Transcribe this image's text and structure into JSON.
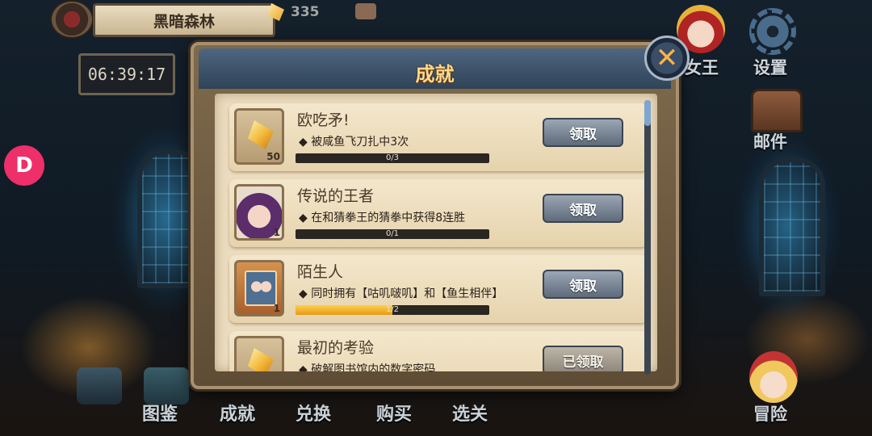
{
  "top_bar": {
    "location": "黑暗森林",
    "timer": "06:39:17",
    "gem_count": "335"
  },
  "app_badge": "D",
  "right_menu": {
    "queen_label": "女王",
    "settings_label": "设置",
    "mail_label": "邮件",
    "adventure_label": "冒险"
  },
  "bottom_nav": {
    "items": [
      "图鉴",
      "成就",
      "兑换",
      "购买",
      "选关"
    ]
  },
  "dialog": {
    "title": "成就",
    "close_glyph": "✕",
    "achievements": [
      {
        "title": "欧吃矛!",
        "desc": "◆ 被咸鱼飞刀扎中3次",
        "progress_text": "0/3",
        "progress": 0.0,
        "reward_count": "50",
        "reward_type": "gem",
        "button": "领取",
        "claimed": false
      },
      {
        "title": "传说的王者",
        "desc": "◆ 在和猜拳王的猜拳中获得8连胜",
        "progress_text": "0/1",
        "progress": 0.0,
        "reward_count": "1",
        "reward_type": "avatar",
        "button": "领取",
        "claimed": false
      },
      {
        "title": "陌生人",
        "desc": "◆ 同时拥有【咕叽啵叽】和【鱼生相伴】",
        "progress_text": "1/2",
        "progress": 0.5,
        "reward_count": "1",
        "reward_type": "card",
        "button": "领取",
        "claimed": false
      },
      {
        "title": "最初的考验",
        "desc": "◆ 破解图书馆内的数字密码",
        "progress_text": "",
        "progress": 1.0,
        "reward_count": "",
        "reward_type": "gem",
        "button": "已领取",
        "claimed": true
      }
    ]
  }
}
